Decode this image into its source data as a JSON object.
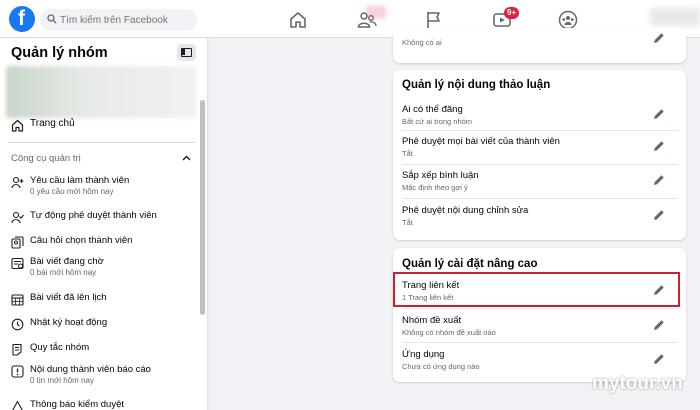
{
  "search": {
    "placeholder": "Tìm kiếm trên Facebook"
  },
  "topnav": {
    "video_badge": "9+"
  },
  "sidebar": {
    "title": "Quản lý nhóm",
    "home_label": "Trang chủ",
    "section_title": "Công cụ quản trị",
    "items": [
      {
        "label": "Yêu cầu làm thành viên",
        "sub": "0 yêu cầu mới hôm nay",
        "icon": "person-add-icon"
      },
      {
        "label": "Tự động phê duyệt thành viên",
        "sub": "",
        "icon": "person-check-icon"
      },
      {
        "label": "Câu hỏi chọn thành viên",
        "sub": "",
        "icon": "questions-icon"
      },
      {
        "label": "Bài viết đang chờ",
        "sub": "0 bài mới hôm nay",
        "icon": "pending-posts-icon"
      },
      {
        "label": "Bài viết đã lên lịch",
        "sub": "",
        "icon": "calendar-icon"
      },
      {
        "label": "Nhật ký hoạt động",
        "sub": "",
        "icon": "clock-icon"
      },
      {
        "label": "Quy tắc nhóm",
        "sub": "",
        "icon": "rules-icon"
      },
      {
        "label": "Nội dung thành viên báo cáo",
        "sub": "0 tin mới hôm nay",
        "icon": "report-icon"
      },
      {
        "label": "Thông báo kiểm duyệt",
        "sub": "",
        "icon": "alert-icon"
      }
    ]
  },
  "main": {
    "top_card": {
      "sub": "Không có ai"
    },
    "discussion_card": {
      "title": "Quản lý nội dung thảo luận",
      "rows": [
        {
          "label": "Ai có thể đăng",
          "sub": "Bất cứ ai trong nhóm"
        },
        {
          "label": "Phê duyệt mọi bài viết của thành viên",
          "sub": "Tắt"
        },
        {
          "label": "Sắp xếp bình luận",
          "sub": "Mặc định theo gợi ý"
        },
        {
          "label": "Phê duyệt nội dung chỉnh sửa",
          "sub": "Tắt"
        }
      ]
    },
    "advanced_card": {
      "title": "Quản lý cài đặt nâng cao",
      "rows": [
        {
          "label": "Trang liên kết",
          "sub": "1 Trang liên kết"
        },
        {
          "label": "Nhóm đề xuất",
          "sub": "Không có nhóm đề xuất nào"
        },
        {
          "label": "Ứng dụng",
          "sub": "Chưa có ứng dụng nào"
        }
      ]
    }
  },
  "colors": {
    "accent": "#1877f2",
    "highlight_border": "#c8232c",
    "badge": "#e41e3f"
  },
  "watermark": "mytour.vn"
}
